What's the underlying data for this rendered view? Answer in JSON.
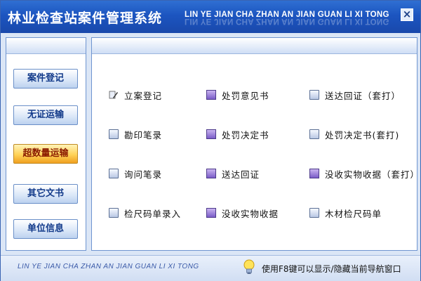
{
  "titlebar": {
    "app_title": "林业检查站案件管理系统",
    "pinyin_title": "LIN YE JIAN CHA ZHAN AN JIAN GUAN LI XI TONG",
    "close_label": "×"
  },
  "sidebar": {
    "items": [
      {
        "label": "案件登记",
        "active": false
      },
      {
        "label": "无证运输",
        "active": false
      },
      {
        "label": "超数量运输",
        "active": true
      },
      {
        "label": "其它文书",
        "active": false
      },
      {
        "label": "单位信息",
        "active": false
      }
    ]
  },
  "main": {
    "items": [
      {
        "label": "立案登记",
        "icon": "pen-icon"
      },
      {
        "label": "处罚意见书",
        "icon": "purple-book-icon"
      },
      {
        "label": "送达回证（套打）",
        "icon": "document-icon"
      },
      {
        "label": "勘印笔录",
        "icon": "document-icon"
      },
      {
        "label": "处罚决定书",
        "icon": "purple-book-icon"
      },
      {
        "label": "处罚决定书(套打)",
        "icon": "document-icon"
      },
      {
        "label": "询问笔录",
        "icon": "document-icon"
      },
      {
        "label": "送达回证",
        "icon": "purple-book-icon"
      },
      {
        "label": "没收实物收据（套打）",
        "icon": "purple-book-icon"
      },
      {
        "label": "检尺码单录入",
        "icon": "document-icon"
      },
      {
        "label": "没收实物收据",
        "icon": "purple-book-icon"
      },
      {
        "label": "木材检尺码单",
        "icon": "document-icon"
      }
    ]
  },
  "statusbar": {
    "pinyin": "LIN YE JIAN CHA ZHAN AN JIAN GUAN LI XI TONG",
    "hint": "使用F8键可以显示/隐藏当前导航窗口",
    "hint_icon": "lightbulb-icon"
  },
  "colors": {
    "title_bar": "#1f5bc6",
    "active_button": "#ffd257",
    "active_text": "#8a1a00",
    "button_text": "#123a8a"
  }
}
